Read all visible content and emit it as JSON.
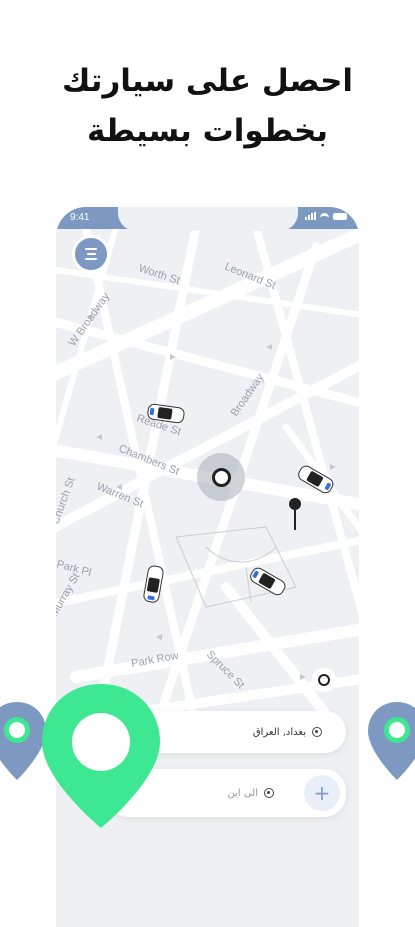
{
  "headline": {
    "line1": "احصل على سيارتك",
    "line2": "بخطوات بسيطة"
  },
  "status_bar": {
    "time": "9:41"
  },
  "map": {
    "streets": [
      "Worth St",
      "Leonard St",
      "W Broadway",
      "Broadway",
      "Reade St",
      "Chambers St",
      "Warren St",
      "Church St",
      "Park Pl",
      "Murray St",
      "Park Row",
      "Spruce St"
    ]
  },
  "trip": {
    "pickup": "بغداد, العراق",
    "destination": "الى اين",
    "add_label": "+"
  },
  "colors": {
    "accent": "#7d99c2",
    "pin_green": "#3ee892",
    "map_bg": "#eef0f3",
    "road": "#ffffff"
  },
  "icons": {
    "menu": "menu-icon",
    "car": "taxi-car-icon",
    "target": "target-icon",
    "pin": "map-pin-icon",
    "plus": "plus-icon"
  }
}
